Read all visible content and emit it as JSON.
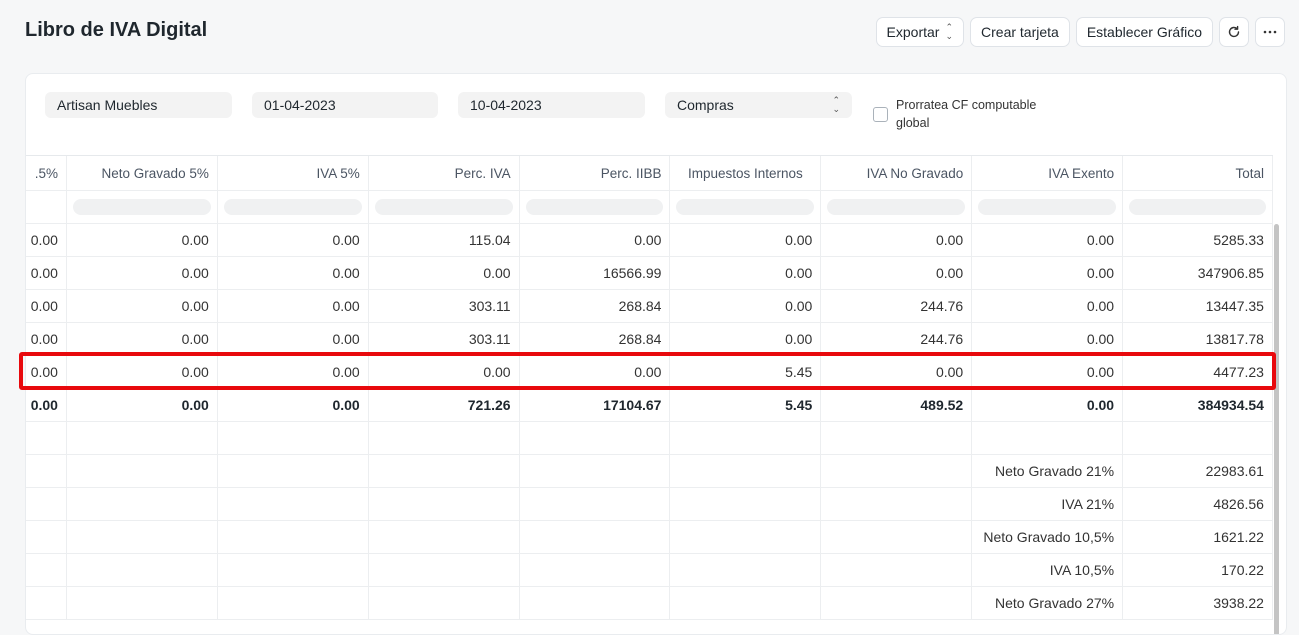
{
  "page": {
    "title": "Libro de IVA Digital"
  },
  "toolbar": {
    "export_label": "Exportar",
    "card_label": "Crear tarjeta",
    "chart_label": "Establecer Gráfico",
    "refresh_icon": "refresh-icon",
    "more_icon": "more-icon"
  },
  "filters": {
    "company": "Artisan Muebles",
    "from_date": "01-04-2023",
    "to_date": "10-04-2023",
    "type": "Compras",
    "prorrata_label": "Prorratea CF computable global"
  },
  "table": {
    "columns": [
      ".5%",
      "Neto Gravado 5%",
      "IVA 5%",
      "Perc. IVA",
      "Perc. IIBB",
      "Impuestos Internos",
      "IVA No Gravado",
      "IVA Exento",
      "Total"
    ],
    "rows": [
      [
        "0.00",
        "0.00",
        "0.00",
        "115.04",
        "0.00",
        "0.00",
        "0.00",
        "0.00",
        "5285.33"
      ],
      [
        "0.00",
        "0.00",
        "0.00",
        "0.00",
        "16566.99",
        "0.00",
        "0.00",
        "0.00",
        "347906.85"
      ],
      [
        "0.00",
        "0.00",
        "0.00",
        "303.11",
        "268.84",
        "0.00",
        "244.76",
        "0.00",
        "13447.35"
      ],
      [
        "0.00",
        "0.00",
        "0.00",
        "303.11",
        "268.84",
        "0.00",
        "244.76",
        "0.00",
        "13817.78"
      ],
      [
        "0.00",
        "0.00",
        "0.00",
        "0.00",
        "0.00",
        "5.45",
        "0.00",
        "0.00",
        "4477.23"
      ]
    ],
    "totals": [
      "0.00",
      "0.00",
      "0.00",
      "721.26",
      "17104.67",
      "5.45",
      "489.52",
      "0.00",
      "384934.54"
    ],
    "summary": [
      {
        "label": "Neto Gravado 21%",
        "value": "22983.61"
      },
      {
        "label": "IVA 21%",
        "value": "4826.56"
      },
      {
        "label": "Neto Gravado 10,5%",
        "value": "1621.22"
      },
      {
        "label": "IVA 10,5%",
        "value": "170.22"
      },
      {
        "label": "Neto Gravado 27%",
        "value": "3938.22"
      }
    ],
    "highlight_color": "#e8090d"
  }
}
